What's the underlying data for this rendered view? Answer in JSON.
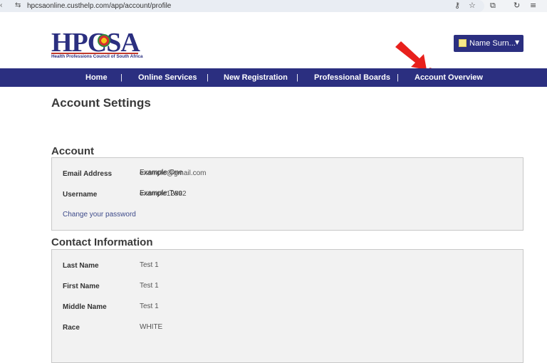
{
  "browser": {
    "back_icon": "back-arrow-icon",
    "url": "hpcsaonline.custhelp.com/app/account/profile",
    "icons": [
      "key-icon",
      "star-icon",
      "extension-icon",
      "refresh-icon",
      "list-icon"
    ]
  },
  "logo": {
    "text": "HPCSA",
    "subtitle": "Health Professions Council of South Africa"
  },
  "user_menu": {
    "name": "Name Surn..."
  },
  "nav": {
    "items": [
      "Home",
      "Online Services",
      "New Registration",
      "Professional Boards",
      "Account Overview"
    ],
    "separator": "|"
  },
  "page": {
    "title": "Account Settings"
  },
  "account": {
    "title": "Account",
    "email_label": "Email Address",
    "email_value": "example@gmail.com",
    "email_overlay": "Example One",
    "username_label": "Username",
    "username_value": "example12882",
    "username_overlay": "Example Two",
    "change_password": "Change your password"
  },
  "contact": {
    "title": "Contact Information",
    "fields": [
      {
        "label": "Last Name",
        "value": "Test 1"
      },
      {
        "label": "First Name",
        "value": "Test 1"
      },
      {
        "label": "Middle Name",
        "value": "Test 1"
      },
      {
        "label": "Race",
        "value": "WHITE"
      }
    ]
  },
  "colors": {
    "brand": "#2b2f80",
    "panel_bg": "#f2f2f2",
    "arrow": "#e8201c"
  }
}
